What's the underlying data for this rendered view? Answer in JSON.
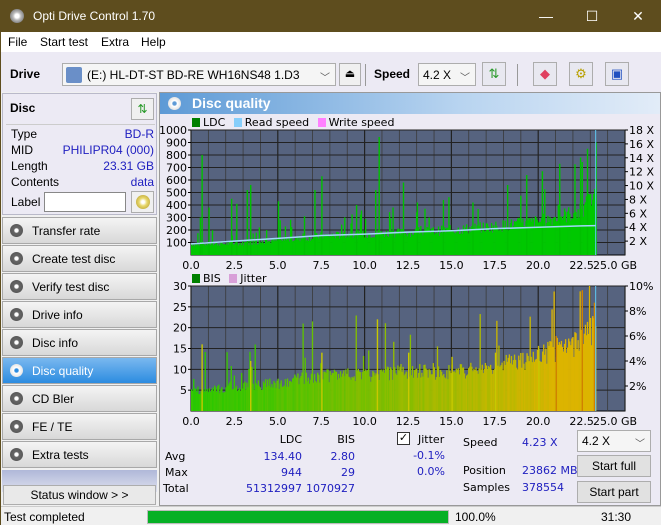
{
  "window": {
    "title": "Opti Drive Control 1.70",
    "minimize": "—",
    "maximize": "☐",
    "close": "✕"
  },
  "menu": [
    "File",
    "Start test",
    "Extra",
    "Help"
  ],
  "toolbar": {
    "drive_label": "Drive",
    "drive_value": "(E:)  HL-DT-ST BD-RE  WH16NS48 1.D3",
    "speed_label": "Speed",
    "speed_value": "4.2 X",
    "icons": [
      "eject-icon",
      "refresh-icon",
      "eraser-icon",
      "settings-icon",
      "save-icon"
    ]
  },
  "disc": {
    "header": "Disc",
    "rows": [
      {
        "key": "Type",
        "value": "BD-R"
      },
      {
        "key": "MID",
        "value": "PHILIPR04 (000)"
      },
      {
        "key": "Length",
        "value": "23.31 GB"
      },
      {
        "key": "Contents",
        "value": "data"
      }
    ],
    "label_key": "Label",
    "label_value": ""
  },
  "nav": [
    {
      "label": "Transfer rate",
      "active": false
    },
    {
      "label": "Create test disc",
      "active": false
    },
    {
      "label": "Verify test disc",
      "active": false
    },
    {
      "label": "Drive info",
      "active": false
    },
    {
      "label": "Disc info",
      "active": false
    },
    {
      "label": "Disc quality",
      "active": true
    },
    {
      "label": "CD Bler",
      "active": false
    },
    {
      "label": "FE / TE",
      "active": false
    },
    {
      "label": "Extra tests",
      "active": false
    }
  ],
  "status_window_button": "Status window > >",
  "panel": {
    "title": "Disc quality"
  },
  "chart_data": [
    {
      "type": "bar",
      "title": "LDC",
      "legend": [
        {
          "name": "LDC",
          "color": "#008000"
        },
        {
          "name": "Read speed",
          "color": "#87cefa"
        },
        {
          "name": "Write speed",
          "color": "#ff80ff"
        }
      ],
      "xlabel": "GB",
      "xlim": [
        0,
        25
      ],
      "xticks": [
        "0.0",
        "2.5",
        "5.0",
        "7.5",
        "10.0",
        "12.5",
        "15.0",
        "17.5",
        "20.0",
        "22.5",
        "25.0 GB"
      ],
      "ylim": [
        0,
        1000
      ],
      "yticks": [
        "100",
        "200",
        "300",
        "400",
        "500",
        "600",
        "700",
        "800",
        "900",
        "1000"
      ],
      "y2lim": [
        0,
        18
      ],
      "y2ticks": [
        "2 X",
        "4 X",
        "6 X",
        "8 X",
        "10 X",
        "12 X",
        "14 X",
        "16 X",
        "18 X"
      ],
      "data_end_gb": 23.31,
      "ldc_baseline": [
        [
          0,
          90
        ],
        [
          2.5,
          95
        ],
        [
          5.0,
          120
        ],
        [
          7.5,
          160
        ],
        [
          10.0,
          175
        ],
        [
          12.5,
          190
        ],
        [
          15.0,
          210
        ],
        [
          17.5,
          240
        ],
        [
          20.0,
          280
        ],
        [
          22.5,
          370
        ],
        [
          23.31,
          520
        ]
      ],
      "ldc_spikes": [
        [
          0.6,
          800
        ],
        [
          0.5,
          300
        ],
        [
          1.0,
          380
        ],
        [
          2.3,
          450
        ],
        [
          2.6,
          410
        ],
        [
          3.2,
          520
        ],
        [
          3.4,
          560
        ],
        [
          5.0,
          430
        ],
        [
          6.5,
          310
        ],
        [
          7.1,
          520
        ],
        [
          7.5,
          630
        ],
        [
          9.5,
          400
        ],
        [
          10.6,
          520
        ],
        [
          10.8,
          944
        ],
        [
          11.6,
          380
        ],
        [
          12.2,
          580
        ],
        [
          13.0,
          420
        ],
        [
          14.5,
          440
        ],
        [
          16.2,
          420
        ],
        [
          18.2,
          560
        ],
        [
          19.3,
          640
        ],
        [
          20.2,
          670
        ],
        [
          21.2,
          730
        ],
        [
          22.4,
          780
        ],
        [
          22.8,
          850
        ],
        [
          23.3,
          900
        ]
      ],
      "read_speed_x": [
        [
          0,
          1.6
        ],
        [
          2.5,
          2.0
        ],
        [
          5.0,
          2.4
        ],
        [
          7.5,
          2.8
        ],
        [
          10.0,
          3.0
        ],
        [
          12.5,
          3.3
        ],
        [
          15.0,
          3.5
        ],
        [
          17.5,
          3.8
        ],
        [
          20.0,
          4.0
        ],
        [
          22.5,
          4.2
        ],
        [
          23.31,
          4.23
        ]
      ]
    },
    {
      "type": "bar",
      "title": "BIS",
      "legend": [
        {
          "name": "BIS",
          "color": "#008000"
        },
        {
          "name": "Jitter",
          "color": "#d8a0d8"
        }
      ],
      "xlabel": "GB",
      "xlim": [
        0,
        25
      ],
      "xticks": [
        "0.0",
        "2.5",
        "5.0",
        "7.5",
        "10.0",
        "12.5",
        "15.0",
        "17.5",
        "20.0",
        "22.5",
        "25.0 GB"
      ],
      "ylim": [
        0,
        30
      ],
      "yticks": [
        "5",
        "10",
        "15",
        "20",
        "25",
        "30"
      ],
      "y2lim": [
        0,
        10
      ],
      "y2ticks": [
        "2%",
        "4%",
        "6%",
        "8%",
        "10%"
      ],
      "data_end_gb": 23.31,
      "bis_baseline": [
        [
          0,
          5
        ],
        [
          2.5,
          6
        ],
        [
          5.0,
          7
        ],
        [
          7.5,
          9
        ],
        [
          10.0,
          9
        ],
        [
          12.5,
          10
        ],
        [
          15.0,
          10
        ],
        [
          17.5,
          11
        ],
        [
          20.0,
          14
        ],
        [
          22.5,
          17
        ],
        [
          23.31,
          22
        ]
      ],
      "bis_spikes": [
        [
          0.6,
          16
        ],
        [
          3.4,
          12
        ],
        [
          7.5,
          14
        ],
        [
          10.7,
          22
        ],
        [
          12.5,
          14
        ],
        [
          15.0,
          13
        ],
        [
          17.5,
          14
        ],
        [
          20.0,
          15
        ],
        [
          21.0,
          18
        ],
        [
          22.5,
          29
        ],
        [
          23.2,
          26
        ]
      ]
    }
  ],
  "stats": {
    "col_ldc": "LDC",
    "col_bis": "BIS",
    "rows": [
      {
        "label": "Avg",
        "ldc": "134.40",
        "bis": "2.80"
      },
      {
        "label": "Max",
        "ldc": "944",
        "bis": "29"
      },
      {
        "label": "Total",
        "ldc": "51312997",
        "bis": "1070927"
      }
    ],
    "jitter_label": "Jitter",
    "jitter_checked": true,
    "jitter_avg": "-0.1%",
    "jitter_max": "0.0%",
    "speed_label": "Speed",
    "speed_value": "4.23 X",
    "position_label": "Position",
    "position_value": "23862 MB",
    "samples_label": "Samples",
    "samples_value": "378554",
    "speed_select": "4.2 X",
    "start_full": "Start full",
    "start_part": "Start part"
  },
  "statusbar": {
    "text": "Test completed",
    "progress": 100.0,
    "progress_text": "100.0%",
    "time": "31:30"
  }
}
